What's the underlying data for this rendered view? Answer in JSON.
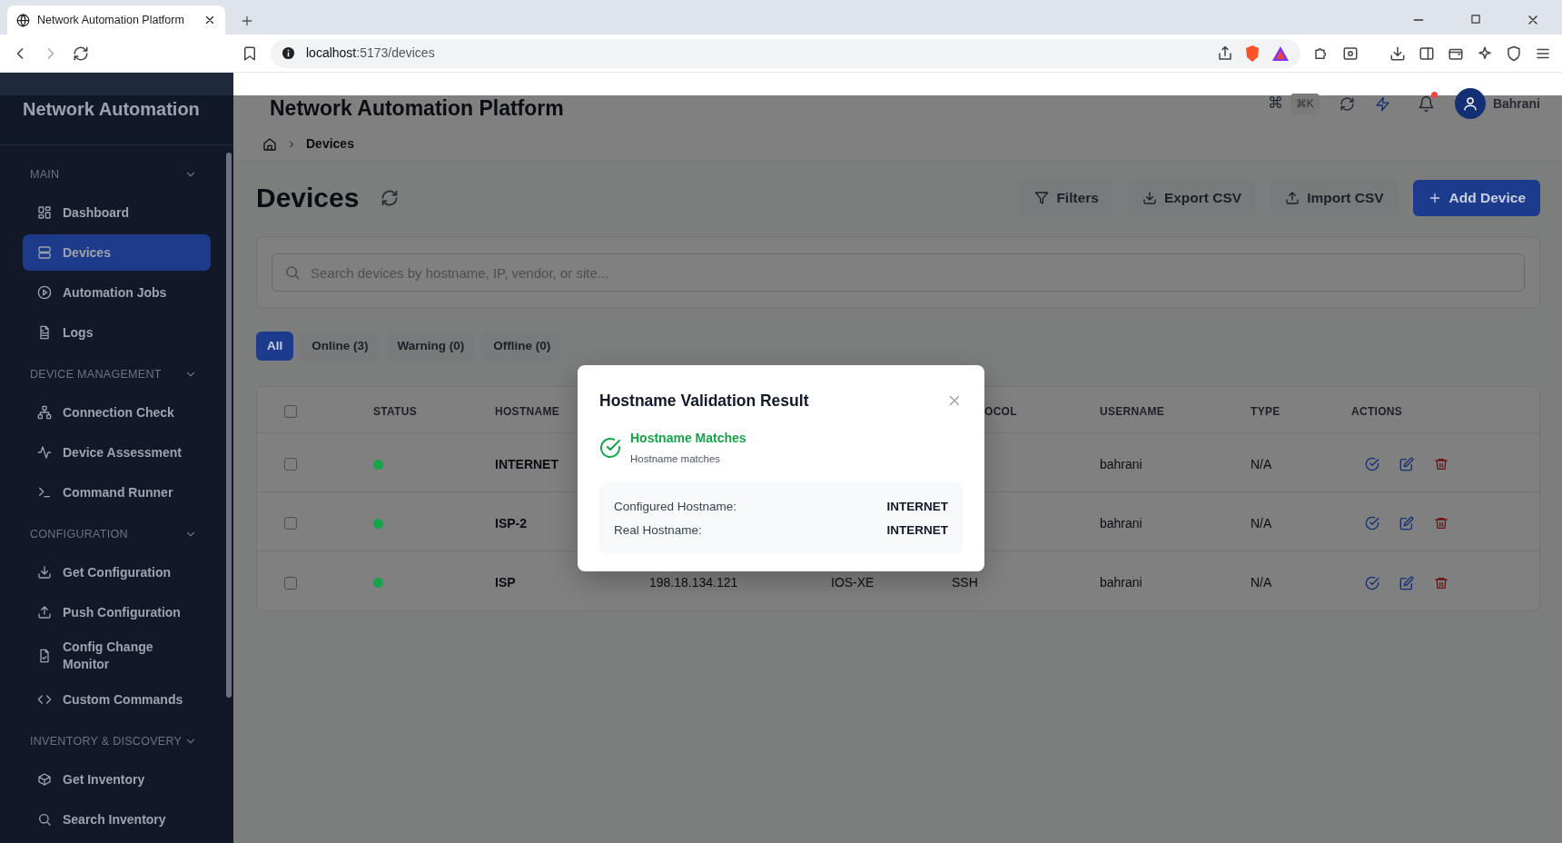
{
  "browser": {
    "tab_title": "Network Automation Platform",
    "url_host": "localhost",
    "url_path": ":5173/devices"
  },
  "sidebar": {
    "title": "Network Automation",
    "sections": [
      {
        "label": "MAIN",
        "expanded": true,
        "items": [
          {
            "label": "Dashboard",
            "selected": false
          },
          {
            "label": "Devices",
            "selected": true
          },
          {
            "label": "Automation Jobs",
            "selected": false
          },
          {
            "label": "Logs",
            "selected": false
          }
        ]
      },
      {
        "label": "DEVICE MANAGEMENT",
        "expanded": true,
        "items": [
          {
            "label": "Connection Check",
            "selected": false
          },
          {
            "label": "Device Assessment",
            "selected": false
          },
          {
            "label": "Command Runner",
            "selected": false
          }
        ]
      },
      {
        "label": "CONFIGURATION",
        "expanded": true,
        "items": [
          {
            "label": "Get Configuration",
            "selected": false
          },
          {
            "label": "Push Configuration",
            "selected": false
          },
          {
            "label": "Config Change Monitor",
            "selected": false
          },
          {
            "label": "Custom Commands",
            "selected": false
          }
        ]
      },
      {
        "label": "INVENTORY & DISCOVERY",
        "expanded": true,
        "items": [
          {
            "label": "Get Inventory",
            "selected": false
          },
          {
            "label": "Search Inventory",
            "selected": false
          }
        ]
      }
    ]
  },
  "header": {
    "title": "Network Automation Platform",
    "command_glyph": "⌘",
    "shortcut": "⌘K",
    "has_unread_notifications": true,
    "user": "Bahrani",
    "breadcrumb": [
      "Devices"
    ]
  },
  "page": {
    "title": "Devices",
    "buttons": [
      {
        "label": "Filters",
        "kind": "secondary"
      },
      {
        "label": "Export CSV",
        "kind": "secondary"
      },
      {
        "label": "Import CSV",
        "kind": "secondary"
      },
      {
        "label": "Add Device",
        "kind": "primary"
      }
    ],
    "search": {
      "placeholder": "Search devices by hostname, IP, vendor, or site..."
    },
    "filters": [
      {
        "label": "All",
        "selected": true
      },
      {
        "label": "Online (3)",
        "selected": false
      },
      {
        "label": "Warning (0)",
        "selected": false
      },
      {
        "label": "Offline (0)",
        "selected": false
      }
    ]
  },
  "table": {
    "select_all_checked": false,
    "columns": [
      "STATUS",
      "HOSTNAME",
      "OCOL",
      "USERNAME",
      "TYPE",
      "ACTIONS"
    ],
    "rows": [
      {
        "checked": false,
        "color": "#16a34a",
        "hostname": "INTERNET",
        "username": "bahrani",
        "type": "N/A"
      },
      {
        "checked": false,
        "color": "#16a34a",
        "hostname": "ISP-2",
        "username": "bahrani",
        "type": "N/A"
      },
      {
        "checked": false,
        "color": "#16a34a",
        "hostname": "ISP",
        "column_4": "198.18.134.121",
        "column_5": "IOS-XE",
        "column_6": "SSH",
        "username": "bahrani",
        "type": "N/A"
      }
    ]
  },
  "modal": {
    "title": "Hostname Validation Result",
    "success": true,
    "result_title": "Hostname Matches",
    "result_text": "Hostname matches",
    "details": [
      {
        "label": "Configured Hostname:",
        "value": "INTERNET"
      },
      {
        "label": "Real Hostname:",
        "value": "INTERNET"
      }
    ]
  }
}
